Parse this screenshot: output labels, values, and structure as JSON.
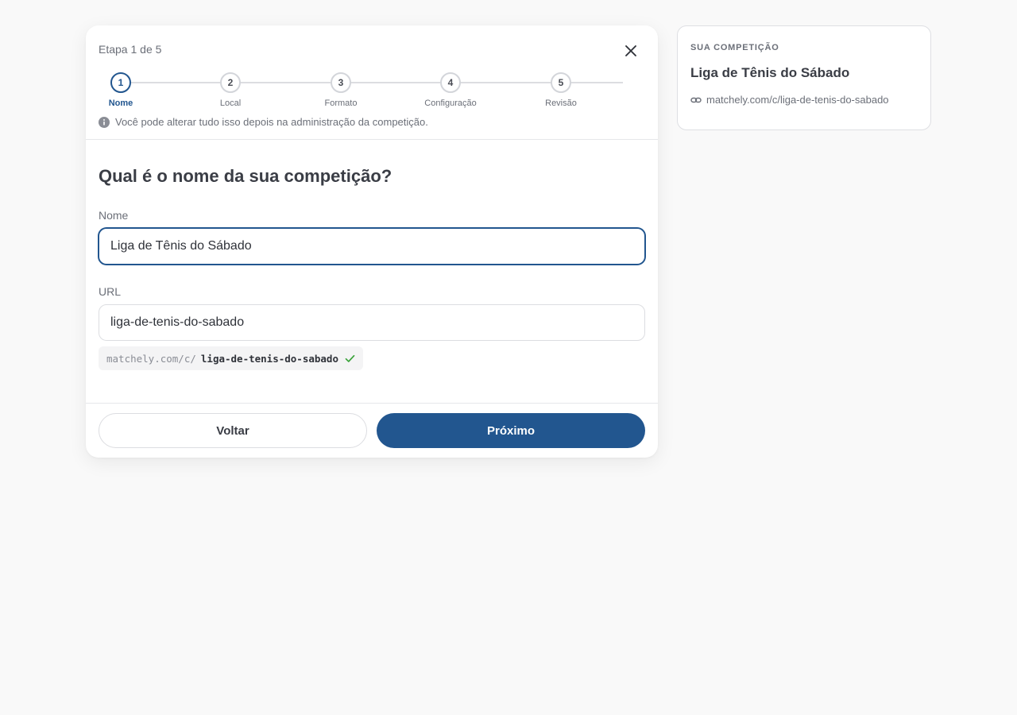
{
  "wizard": {
    "step_counter": "Etapa 1 de 5",
    "steps": [
      {
        "number": "1",
        "label": "Nome"
      },
      {
        "number": "2",
        "label": "Local"
      },
      {
        "number": "3",
        "label": "Formato"
      },
      {
        "number": "4",
        "label": "Configuração"
      },
      {
        "number": "5",
        "label": "Revisão"
      }
    ],
    "active_step": 1,
    "hint": "Você pode alterar tudo isso depois na administração da competição.",
    "question": "Qual é o nome da sua competição?",
    "name_field": {
      "label": "Nome",
      "value": "Liga de Tênis do Sábado"
    },
    "url_field": {
      "label": "URL",
      "value": "liga-de-tenis-do-sabado"
    },
    "url_preview": {
      "prefix": "matchely.com/c/",
      "slug": "liga-de-tenis-do-sabado",
      "status_icon": "check-icon"
    },
    "buttons": {
      "back": "Voltar",
      "next": "Próximo"
    }
  },
  "summary": {
    "label": "SUA COMPETIÇÃO",
    "title": "Liga de Tênis do Sábado",
    "url": "matchely.com/c/liga-de-tenis-do-sabado",
    "url_icon": "link-icon"
  },
  "colors": {
    "primary": "#22568f",
    "success": "#3ba33b",
    "background": "#f9f9f9"
  }
}
